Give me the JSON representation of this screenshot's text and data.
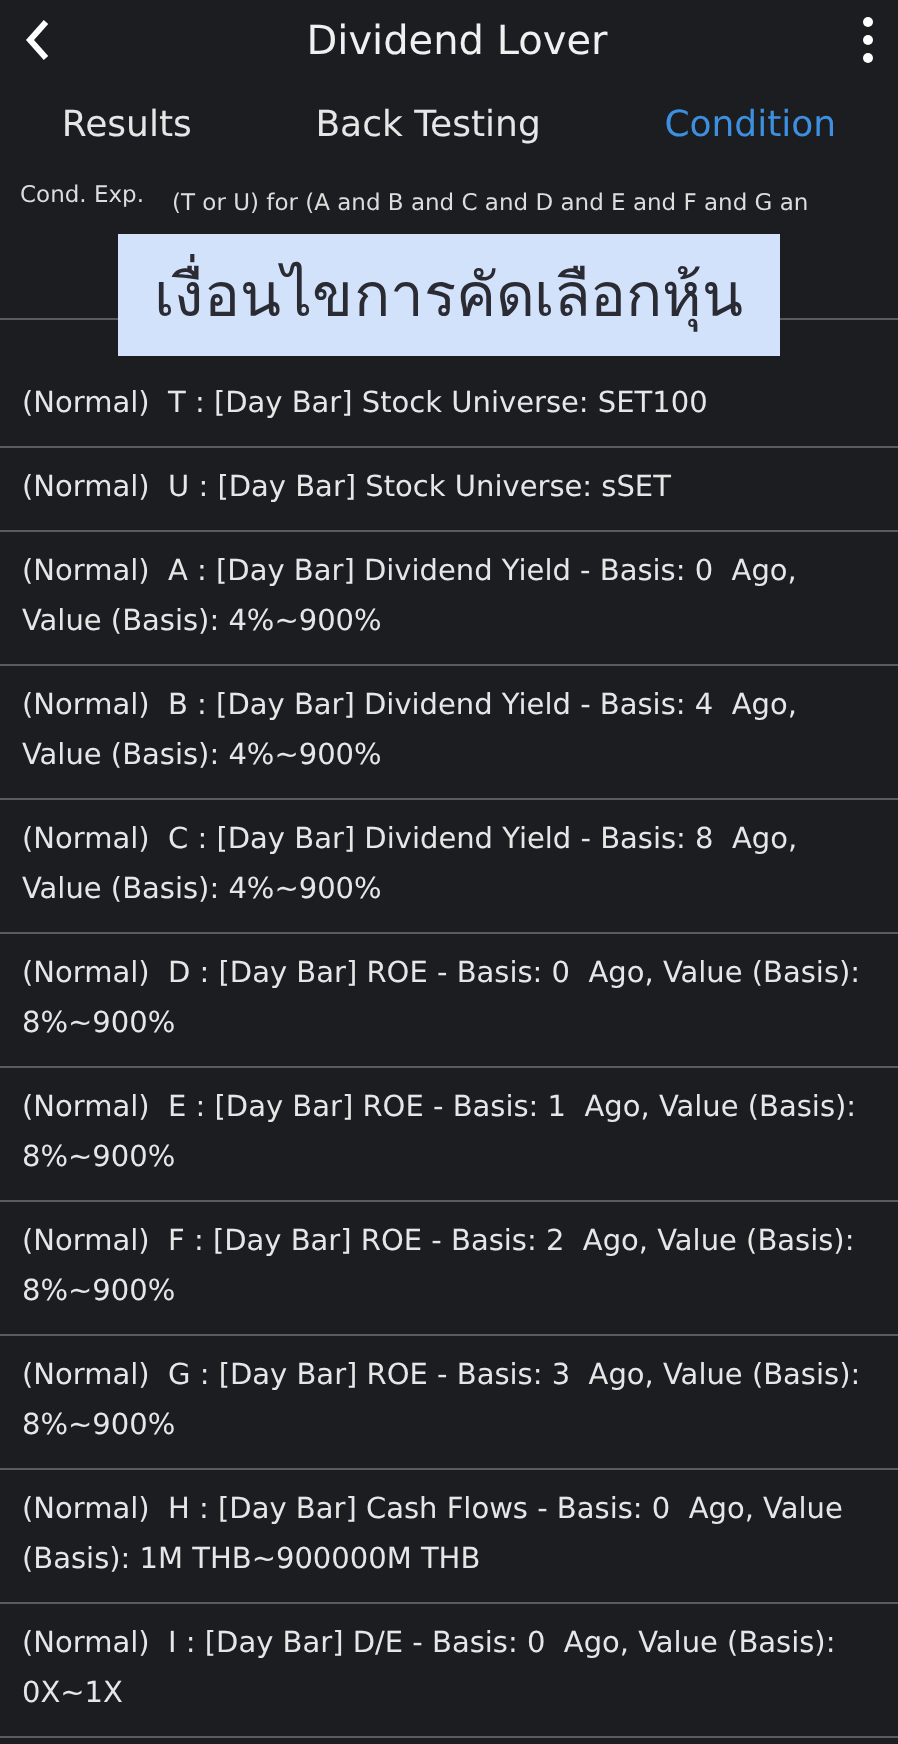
{
  "header": {
    "title": "Dividend Lover"
  },
  "tabs": [
    {
      "label": "Results",
      "selected": false
    },
    {
      "label": "Back Testing",
      "selected": false
    },
    {
      "label": "Condition",
      "selected": true
    }
  ],
  "condition_expression": {
    "label": "Cond. Exp.",
    "value": "(T or U) for (A and B and C and D and E and F and G an"
  },
  "overlay_caption": "เงื่อนไขการคัดเลือกหุ้น",
  "conditions": [
    {
      "text": "(Normal)  T : [Day Bar] Stock Universe: SET100"
    },
    {
      "text": "(Normal)  U : [Day Bar] Stock Universe: sSET"
    },
    {
      "text": "(Normal)  A : [Day Bar] Dividend Yield - Basis: 0  Ago, Value (Basis): 4%~900%"
    },
    {
      "text": "(Normal)  B : [Day Bar] Dividend Yield - Basis: 4  Ago, Value (Basis): 4%~900%"
    },
    {
      "text": "(Normal)  C : [Day Bar] Dividend Yield - Basis: 8  Ago, Value (Basis): 4%~900%"
    },
    {
      "text": "(Normal)  D : [Day Bar] ROE - Basis: 0  Ago, Value (Basis): 8%~900%"
    },
    {
      "text": "(Normal)  E : [Day Bar] ROE - Basis: 1  Ago, Value (Basis): 8%~900%"
    },
    {
      "text": "(Normal)  F : [Day Bar] ROE - Basis: 2  Ago, Value (Basis): 8%~900%"
    },
    {
      "text": "(Normal)  G : [Day Bar] ROE - Basis: 3  Ago, Value (Basis): 8%~900%"
    },
    {
      "text": "(Normal)  H : [Day Bar] Cash Flows - Basis: 0  Ago, Value (Basis): 1M THB~900000M THB"
    },
    {
      "text": "(Normal)  I : [Day Bar] D/E - Basis: 0  Ago, Value (Basis): 0X~1X"
    }
  ]
}
